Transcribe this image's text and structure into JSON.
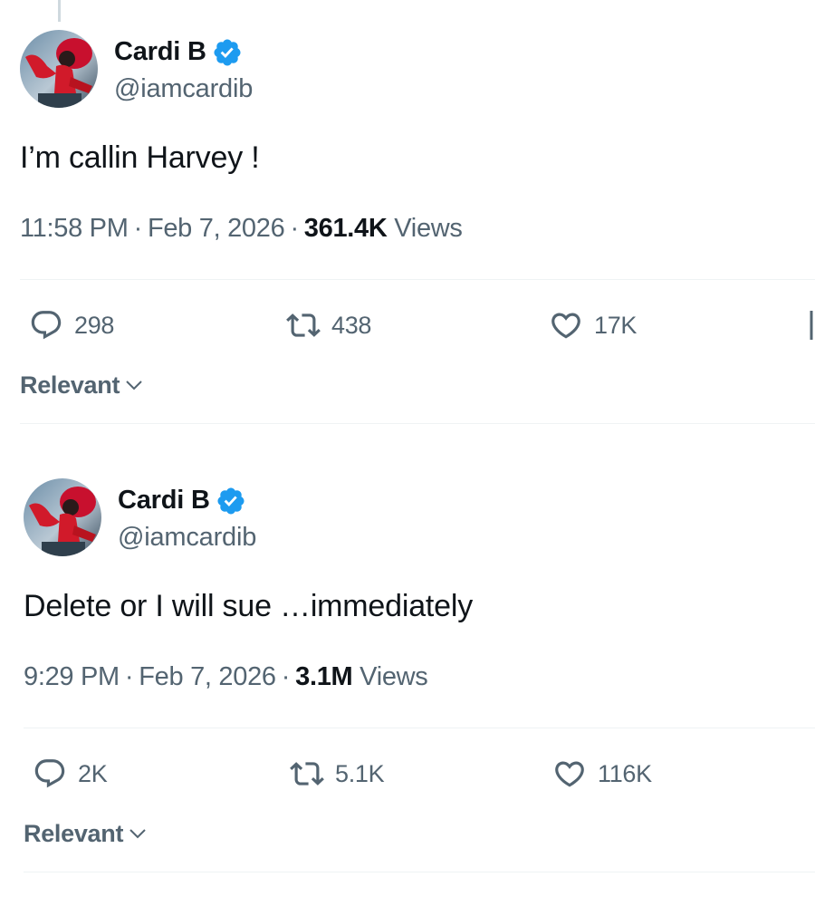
{
  "tweets": [
    {
      "author": {
        "display_name": "Cardi B",
        "handle": "@iamcardib",
        "verified_icon": "verified-badge-icon",
        "badge_color": "#1d9bf0"
      },
      "text": "I’m callin Harvey !",
      "time": "11:58 PM",
      "date": "Feb 7, 2026",
      "views_count": "361.4K",
      "views_label": "Views",
      "replies": "298",
      "retweets": "438",
      "likes": "17K",
      "sort_label": "Relevant"
    },
    {
      "author": {
        "display_name": "Cardi B",
        "handle": "@iamcardib",
        "verified_icon": "verified-badge-icon",
        "badge_color": "#1d9bf0"
      },
      "text": "Delete or I will sue …immediately",
      "time": "9:29 PM",
      "date": "Feb 7, 2026",
      "views_count": "3.1M",
      "views_label": "Views",
      "replies": "2K",
      "retweets": "5.1K",
      "likes": "116K",
      "sort_label": "Relevant"
    }
  ],
  "separator": "·",
  "colors": {
    "text_primary": "#0f1419",
    "text_secondary": "#536471",
    "accent": "#1d9bf0",
    "divider": "#eff3f4"
  }
}
